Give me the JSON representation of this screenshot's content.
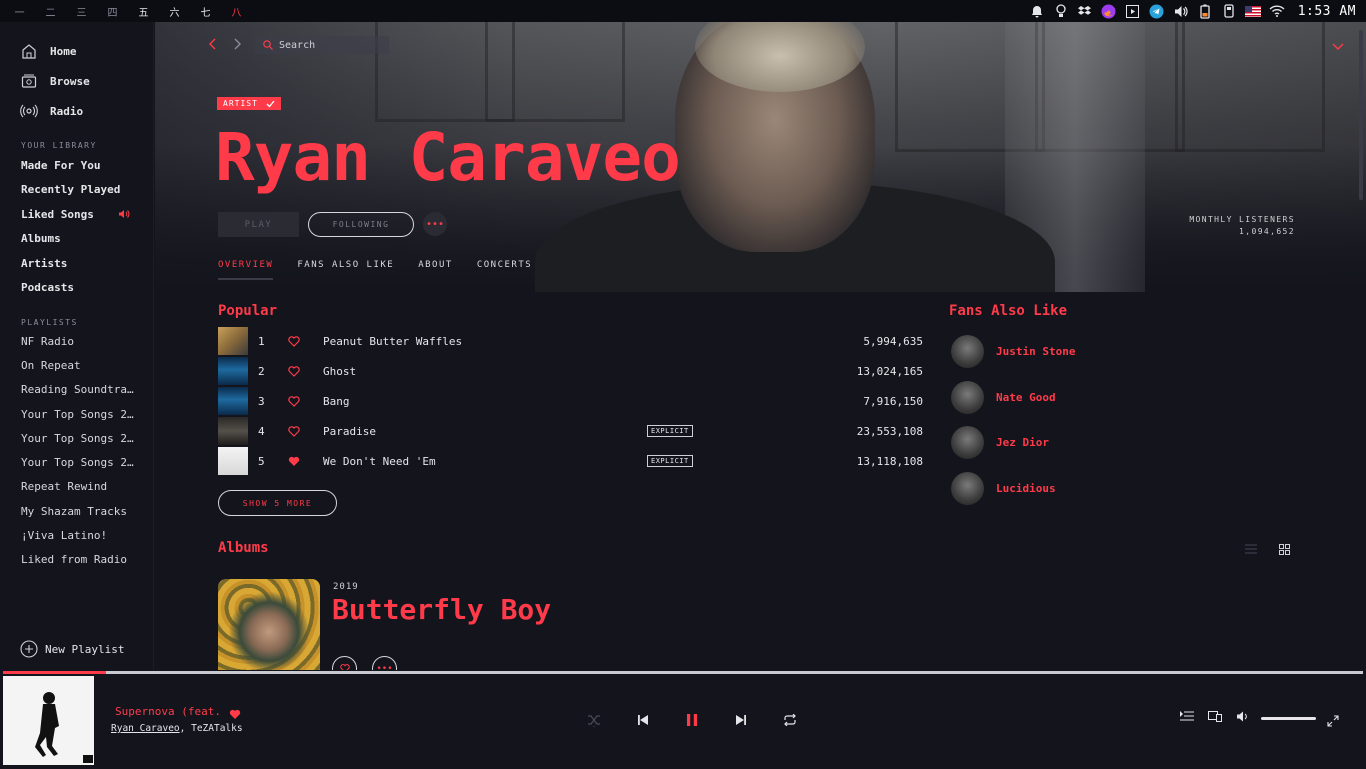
{
  "topbar": {
    "workspaces": [
      "一",
      "二",
      "三",
      "四",
      "五",
      "六",
      "七",
      "八"
    ],
    "active_workspace_index": 7,
    "clock": "1:53 AM",
    "tray_icons": [
      "bell-icon",
      "bulb-icon",
      "dropbox-icon",
      "firefox-icon",
      "media-icon",
      "telegram-icon",
      "volume-icon",
      "battery-icon",
      "phone-icon",
      "flag-us-icon",
      "wifi-icon"
    ]
  },
  "sidebar": {
    "nav": [
      {
        "label": "Home",
        "icon": "home-icon"
      },
      {
        "label": "Browse",
        "icon": "browse-icon"
      },
      {
        "label": "Radio",
        "icon": "radio-icon"
      }
    ],
    "library_heading": "YOUR LIBRARY",
    "library": [
      "Made For You",
      "Recently Played",
      "Liked Songs",
      "Albums",
      "Artists",
      "Podcasts"
    ],
    "playlists_heading": "PLAYLISTS",
    "playlists": [
      "NF Radio",
      "On Repeat",
      "Reading Soundtra…",
      "Your Top Songs 2…",
      "Your Top Songs 2…",
      "Your Top Songs 2…",
      "Repeat Rewind",
      "My Shazam Tracks",
      "¡Viva Latino!",
      "Liked from Radio"
    ],
    "new_playlist": "New Playlist"
  },
  "header": {
    "search_placeholder": "Search",
    "badge": "ARTIST",
    "artist_name": "Ryan Caraveo",
    "play_label": "PLAY",
    "follow_label": "FOLLOWING",
    "more_label": "•••",
    "listeners_label": "MONTHLY LISTENERS",
    "listeners_value": "1,094,652",
    "tabs": [
      "OVERVIEW",
      "FANS ALSO LIKE",
      "ABOUT",
      "CONCERTS"
    ]
  },
  "popular": {
    "heading": "Popular",
    "tracks": [
      {
        "num": "1",
        "title": "Peanut Butter Waffles",
        "plays": "5,994,635",
        "explicit": "",
        "liked": false
      },
      {
        "num": "2",
        "title": "Ghost",
        "plays": "13,024,165",
        "explicit": "",
        "liked": false
      },
      {
        "num": "3",
        "title": "Bang",
        "plays": "7,916,150",
        "explicit": "",
        "liked": false
      },
      {
        "num": "4",
        "title": "Paradise",
        "plays": "23,553,108",
        "explicit": "EXPLICIT",
        "liked": false
      },
      {
        "num": "5",
        "title": "We Don't Need 'Em",
        "plays": "13,118,108",
        "explicit": "EXPLICIT",
        "liked": true
      }
    ],
    "show_more": "SHOW 5 MORE"
  },
  "fans": {
    "heading": "Fans Also Like",
    "artists": [
      "Justin Stone",
      "Nate Good",
      "Jez Dior",
      "Lucidious"
    ]
  },
  "albums": {
    "heading": "Albums",
    "items": [
      {
        "year": "2019",
        "title": "Butterfly Boy"
      }
    ]
  },
  "player": {
    "title": "Supernova (feat.",
    "artist_main": "Ryan Caraveo",
    "artist_sep": ", ",
    "artist_feat": "TeZATalks",
    "progress": 0.076,
    "volume": 1.0
  },
  "colors": {
    "accent": "#ff3b4a",
    "background": "#13141c",
    "sidebar": "#13141c",
    "text": "#e6e6ea"
  }
}
